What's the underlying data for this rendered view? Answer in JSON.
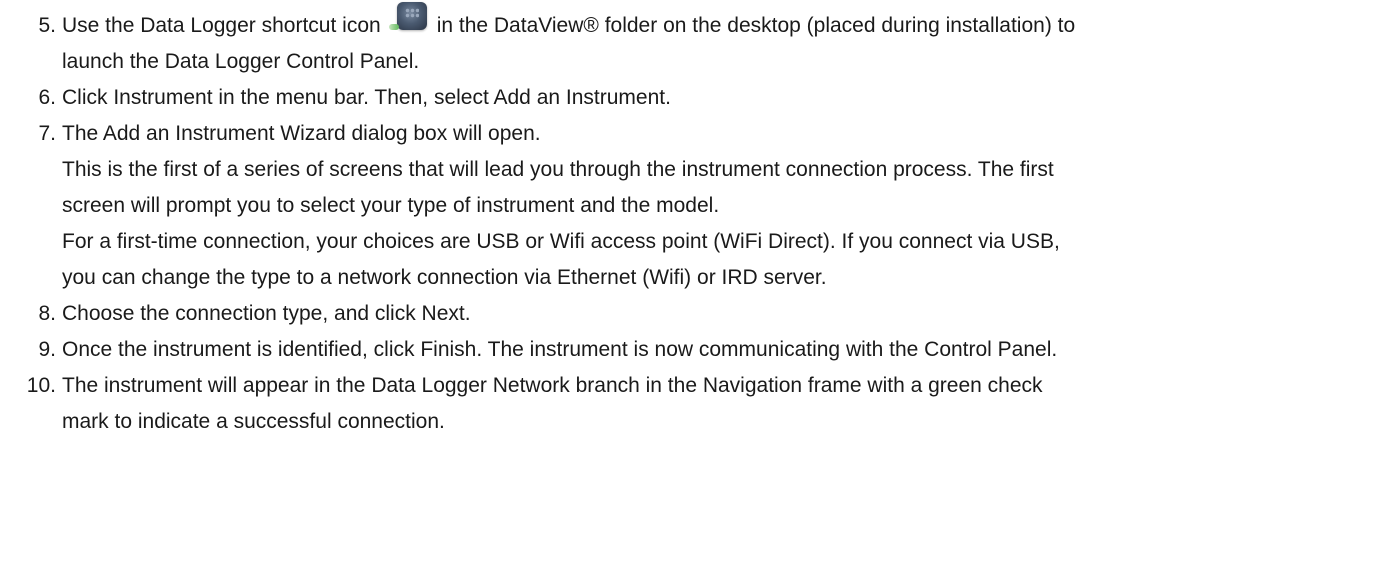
{
  "steps": [
    {
      "number": "5.",
      "lines": [
        {
          "before_icon": "Use the Data Logger shortcut icon",
          "after_icon": "in the DataView® folder on the desktop (placed during installation) to"
        },
        {
          "text": "launch the Data Logger Control Panel."
        }
      ],
      "icon": "data-logger-shortcut-icon"
    },
    {
      "number": "6.",
      "lines": [
        {
          "text": "Click Instrument in the menu bar. Then, select Add an Instrument."
        }
      ]
    },
    {
      "number": "7.",
      "lines": [
        {
          "text": "The Add an Instrument Wizard dialog box will open."
        },
        {
          "text": "This is the first of a series of screens that will lead you through the instrument connection process. The first"
        },
        {
          "text": "screen will prompt you to select your type of instrument and the model."
        },
        {
          "text": "For a first-time connection, your choices are USB or Wifi access point (WiFi Direct). If you connect via USB,"
        },
        {
          "text": "you can change the type to a network connection via Ethernet (Wifi) or IRD server."
        }
      ]
    },
    {
      "number": "8.",
      "lines": [
        {
          "text": "Choose the connection type, and click Next."
        }
      ]
    },
    {
      "number": "9.",
      "lines": [
        {
          "text": "Once the instrument is identified, click Finish. The instrument is now communicating with the Control Panel."
        }
      ]
    },
    {
      "number": "10.",
      "lines": [
        {
          "text": "The instrument will appear in the Data Logger Network branch in the Navigation frame with a green check"
        },
        {
          "text": "mark to indicate a successful connection."
        }
      ]
    }
  ]
}
